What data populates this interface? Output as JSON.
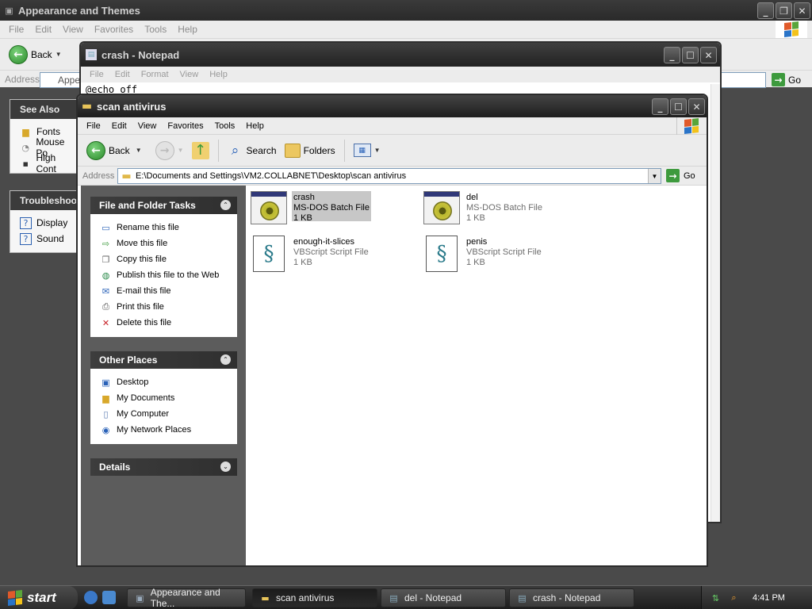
{
  "bg_window": {
    "title": "Appearance and Themes",
    "menu": [
      "File",
      "Edit",
      "View",
      "Favorites",
      "Tools",
      "Help"
    ],
    "back_label": "Back",
    "address_label": "Address",
    "address_value": "Appea",
    "go_label": "Go",
    "see_also": {
      "header": "See Also",
      "items": [
        "Fonts",
        "Mouse Po",
        "High Cont"
      ]
    },
    "troubleshoot": {
      "header": "Troubleshoo",
      "items": [
        "Display",
        "Sound"
      ]
    }
  },
  "notepad": {
    "title": "crash - Notepad",
    "menu": [
      "File",
      "Edit",
      "Format",
      "View",
      "Help"
    ],
    "text": "@echo off"
  },
  "explorer": {
    "title": "scan antivirus",
    "menu": [
      "File",
      "Edit",
      "View",
      "Favorites",
      "Tools",
      "Help"
    ],
    "toolbar": {
      "back": "Back",
      "search": "Search",
      "folders": "Folders"
    },
    "address_label": "Address",
    "address_path": "E:\\Documents and Settings\\VM2.COLLABNET\\Desktop\\scan antivirus",
    "go_label": "Go",
    "file_tasks": {
      "header": "File and Folder Tasks",
      "items": [
        "Rename this file",
        "Move this file",
        "Copy this file",
        "Publish this file to the Web",
        "E-mail this file",
        "Print this file",
        "Delete this file"
      ]
    },
    "other_places": {
      "header": "Other Places",
      "items": [
        "Desktop",
        "My Documents",
        "My Computer",
        "My Network Places"
      ]
    },
    "details": {
      "header": "Details"
    },
    "files": [
      {
        "name": "crash",
        "type": "MS-DOS Batch File",
        "size": "1 KB",
        "icon": "batch-file-icon",
        "selected": true
      },
      {
        "name": "del",
        "type": "MS-DOS Batch File",
        "size": "1 KB",
        "icon": "batch-file-icon",
        "selected": false
      },
      {
        "name": "enough-it-slices",
        "type": "VBScript Script File",
        "size": "1 KB",
        "icon": "vbscript-file-icon",
        "selected": false
      },
      {
        "name": "penis",
        "type": "VBScript Script File",
        "size": "1 KB",
        "icon": "vbscript-file-icon",
        "selected": false
      }
    ]
  },
  "taskbar": {
    "start_label": "start",
    "tasks": [
      "Appearance and The...",
      "scan antivirus",
      "del - Notepad",
      "crash - Notepad"
    ],
    "active_task": "scan antivirus",
    "clock": "4:41 PM"
  },
  "colors": {
    "title_dark": "#2a2a2a",
    "selection": "#c7c7c7",
    "go_green": "#3d9a3d"
  }
}
